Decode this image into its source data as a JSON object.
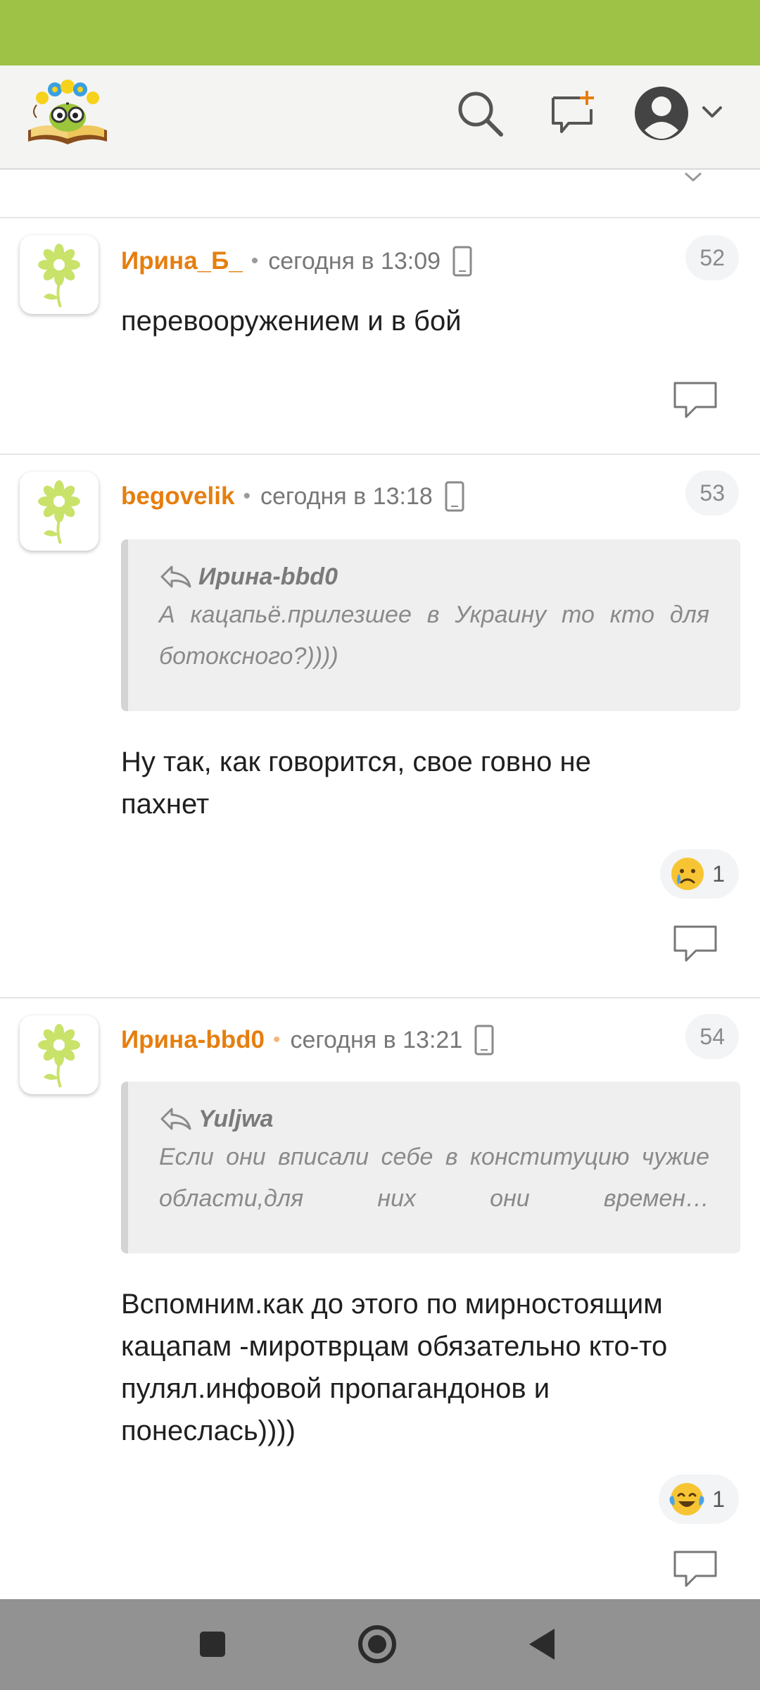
{
  "header": {
    "logo_icon": "book-owl-flower-logo",
    "search_icon": "search-icon",
    "new_message_icon": "new-message-icon",
    "profile_icon": "avatar-icon",
    "colors": {
      "status_bar": "#9dc246",
      "header_bg": "#f4f4f2",
      "accent": "#e67e0e"
    }
  },
  "comments": [
    {
      "author": "Ирина_Б_",
      "time": "сегодня в 13:09",
      "number": "52",
      "text": "перевооружением и в бой"
    },
    {
      "author": "begovelik",
      "time": "сегодня в 13:18",
      "number": "53",
      "quote": {
        "author": "Ирина-bbd0",
        "line1": "А кацапьё.прилезшее в Украину то кто для",
        "line2": "ботоксного?))))"
      },
      "text_lines": [
        "Ну так, как говорится, свое говно не",
        "пахнет"
      ],
      "reaction": {
        "emoji": "crying-face",
        "count": "1"
      }
    },
    {
      "author": "Ирина-bbd0",
      "time": "сегодня в 13:21",
      "number": "54",
      "quote": {
        "author": "Yuljwa",
        "line1": "Если они вписали себе в конституцию чужие",
        "line2": "области,для них они времен…"
      },
      "text_lines": [
        "Вспомним.как до этого по мирностоящим",
        "кацапам -миротврцам обязательно кто-то",
        "пулял.инфовой пропагандонов и",
        "понеслась))))"
      ],
      "reaction": {
        "emoji": "tears-of-joy-face",
        "count": "1"
      }
    }
  ]
}
